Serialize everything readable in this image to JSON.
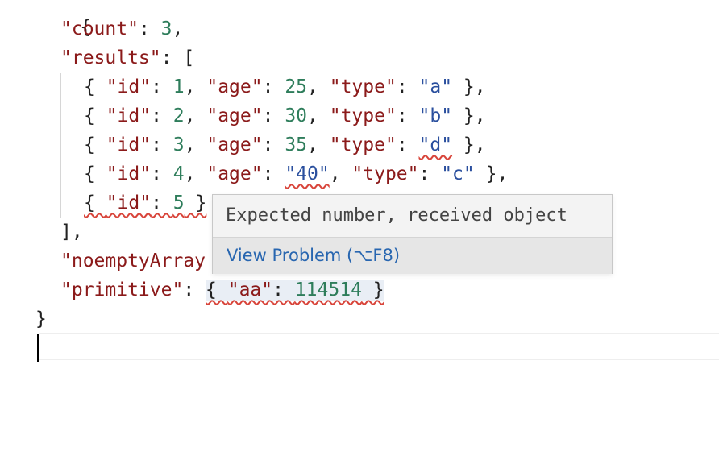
{
  "editor": {
    "tokens": {
      "open_brace": "{",
      "close_brace": "}",
      "count_key": "\"count\"",
      "count_value": "3",
      "results_key": "\"results\"",
      "open_bracket": "[",
      "close_bracket": "],",
      "id_key": "\"id\"",
      "age_key": "\"age\"",
      "type_key": "\"type\"",
      "noempty_key": "\"noemptyArray",
      "primitive_key": "\"primitive\"",
      "aa_key": "\"aa\"",
      "aa_value": "114514"
    },
    "rows": [
      {
        "id": "1",
        "age": "25",
        "type": "\"a\""
      },
      {
        "id": "2",
        "age": "30",
        "type": "\"b\""
      },
      {
        "id": "3",
        "age": "35",
        "type": "\"d\""
      },
      {
        "id": "4",
        "age": "\"40\"",
        "type": "\"c\""
      }
    ],
    "partial_row": {
      "id": "5"
    }
  },
  "hover": {
    "message": "Expected number, received object",
    "action_label": "View Problem (⌥F8)"
  },
  "colors": {
    "key": "#8b1a1a",
    "string": "#2a4f9e",
    "number": "#2e7d5b",
    "error_squiggle": "#d8443a",
    "link": "#2866b0"
  }
}
